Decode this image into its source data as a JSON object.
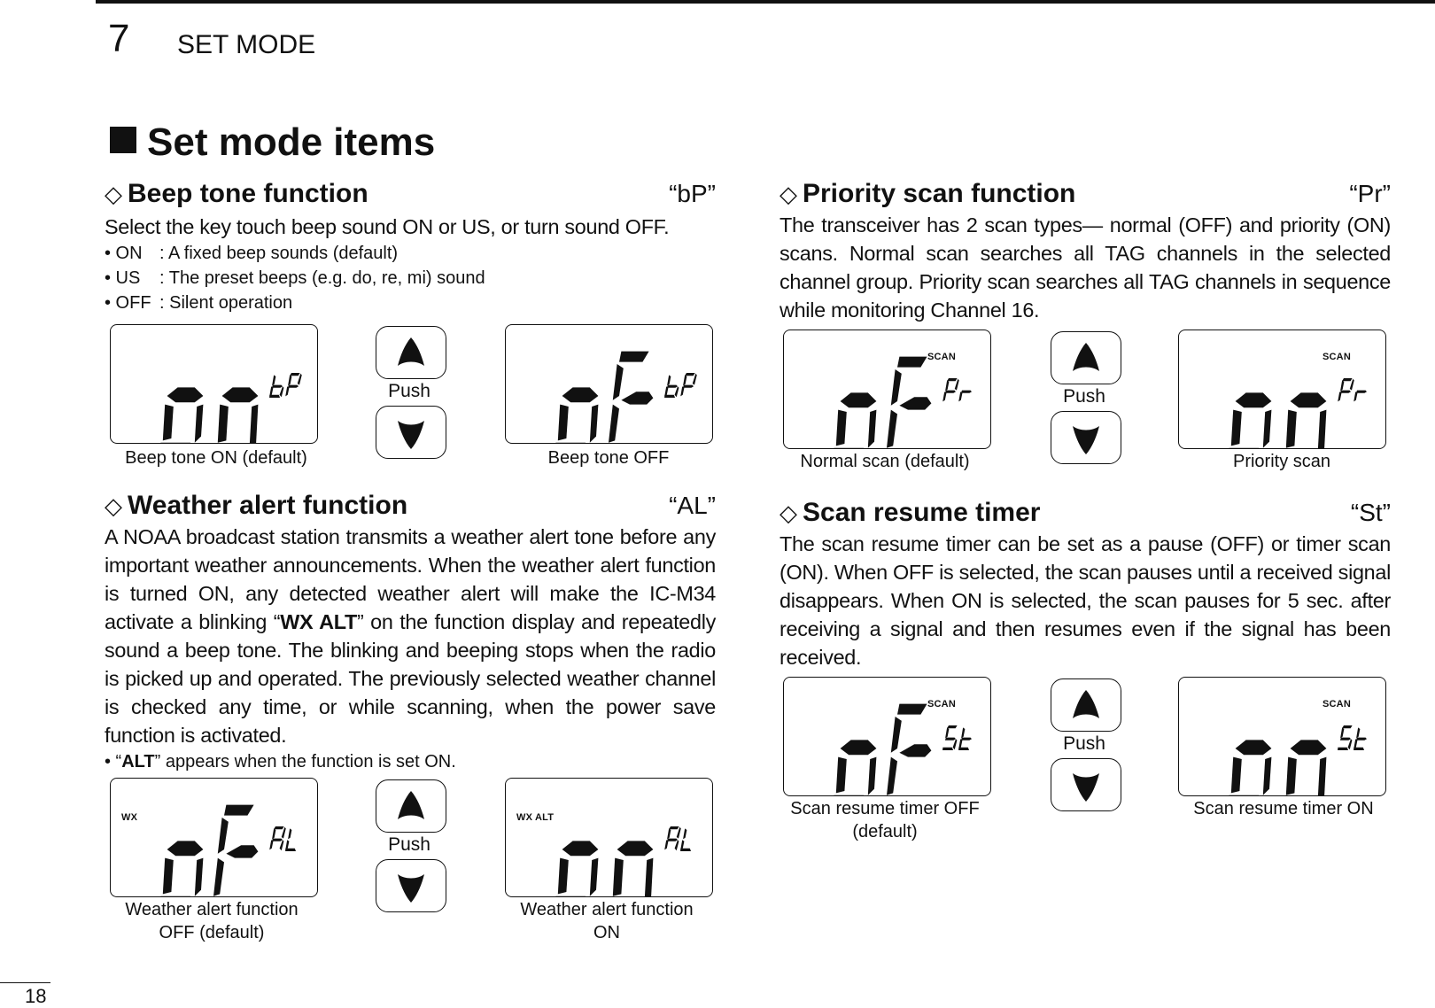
{
  "header": {
    "chapter_number": "7",
    "chapter_title": "SET MODE"
  },
  "page_title": "Set mode items",
  "page_number": "18",
  "sections": {
    "beep": {
      "title": "Beep tone function",
      "code": "“bP”",
      "intro": "Select the key touch beep sound ON or US, or turn sound OFF.",
      "options": [
        {
          "key": "• ON",
          "desc": ": A fixed beep sounds (default)"
        },
        {
          "key": "• US",
          "desc": ": The preset beeps (e.g. do, re, mi) sound"
        },
        {
          "key": "• OFF",
          "desc": ": Silent operation"
        }
      ],
      "figure": {
        "left": {
          "main": "on",
          "sub": "bP",
          "tag": "",
          "caption": "Beep tone ON (default)"
        },
        "right": {
          "main": "oF",
          "sub": "bP",
          "tag": "",
          "caption": "Beep tone OFF"
        },
        "push_label": "Push"
      }
    },
    "weather": {
      "title": "Weather alert function",
      "code": "“AL”",
      "body_parts": {
        "p1": "A NOAA broadcast station transmits a weather alert tone before any important weather announcements. When the weather alert function is turned ON, any detected weather alert will make the IC-M34 activate a blinking “",
        "bold1": "WX ALT",
        "p2": "” on the function display and repeatedly sound a beep tone. The blinking and beeping stops when the radio is picked up and operated. The previously selected weather channel is checked any time, or while scanning, when the power save function is activated."
      },
      "note_parts": {
        "pre": "• “",
        "bold": "ALT",
        "post": "” appears when the function is set ON."
      },
      "figure": {
        "left": {
          "main": "oF",
          "sub": "AL",
          "tag": "WX",
          "caption_line1": "Weather alert function",
          "caption_line2": "OFF (default)"
        },
        "right": {
          "main": "on",
          "sub": "AL",
          "tag": "WX ALT",
          "caption_line1": "Weather alert function",
          "caption_line2": "ON"
        },
        "push_label": "Push"
      }
    },
    "priority": {
      "title": "Priority scan function",
      "code": "“Pr”",
      "body": "The transceiver has 2 scan types— normal (OFF) and priority (ON) scans. Normal scan searches all TAG channels in the selected channel group. Priority scan searches all TAG channels in sequence while monitoring Channel 16.",
      "figure": {
        "left": {
          "main": "oF",
          "sub": "Pr",
          "tag": "SCAN",
          "caption": "Normal scan (default)"
        },
        "right": {
          "main": "on",
          "sub": "Pr",
          "tag": "SCAN",
          "caption": "Priority scan"
        },
        "push_label": "Push"
      }
    },
    "resume": {
      "title": "Scan resume timer",
      "code": "“St”",
      "body": "The scan resume timer can be set as a pause (OFF) or timer scan (ON). When OFF is selected, the scan pauses until a received signal disappears. When ON is selected, the scan pauses for 5 sec. after receiving a signal and then resumes even if the signal has been received.",
      "figure": {
        "left": {
          "main": "oF",
          "sub": "St",
          "tag": "SCAN",
          "caption_line1": "Scan resume timer OFF",
          "caption_line2": "(default)"
        },
        "right": {
          "main": "on",
          "sub": "St",
          "tag": "SCAN",
          "caption": "Scan resume timer ON"
        },
        "push_label": "Push"
      }
    }
  },
  "icons": {
    "section_marker": "◇",
    "title_marker": "■",
    "up_button": "up-arrow-icon",
    "down_button": "down-arrow-icon"
  }
}
